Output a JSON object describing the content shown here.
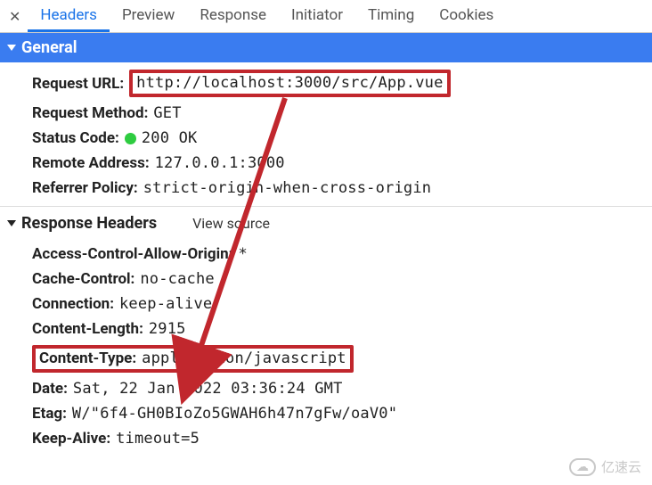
{
  "tabs": {
    "headers": "Headers",
    "preview": "Preview",
    "response": "Response",
    "initiator": "Initiator",
    "timing": "Timing",
    "cookies": "Cookies"
  },
  "sections": {
    "general": "General",
    "response_headers": "Response Headers",
    "view_source": "View source"
  },
  "general": {
    "request_url_k": "Request URL",
    "request_url_v": "http://localhost:3000/src/App.vue",
    "request_method_k": "Request Method",
    "request_method_v": "GET",
    "status_code_k": "Status Code",
    "status_code_v": "200 OK",
    "remote_addr_k": "Remote Address",
    "remote_addr_v": "127.0.0.1:3000",
    "referrer_policy_k": "Referrer Policy",
    "referrer_policy_v": "strict-origin-when-cross-origin"
  },
  "response_headers": {
    "acao_k": "Access-Control-Allow-Origin",
    "acao_v": "*",
    "cache_k": "Cache-Control",
    "cache_v": "no-cache",
    "conn_k": "Connection",
    "conn_v": "keep-alive",
    "clen_k": "Content-Length",
    "clen_v": "2915",
    "ctype_k": "Content-Type",
    "ctype_v": "application/javascript",
    "date_k": "Date",
    "date_v": "Sat, 22 Jan 2022 03:36:24 GMT",
    "etag_k": "Etag",
    "etag_v": "W/\"6f4-GH0BIoZo5GWAH6h47n7gFw/oaV0\"",
    "ka_k": "Keep-Alive",
    "ka_v": "timeout=5"
  },
  "watermark": "亿速云"
}
